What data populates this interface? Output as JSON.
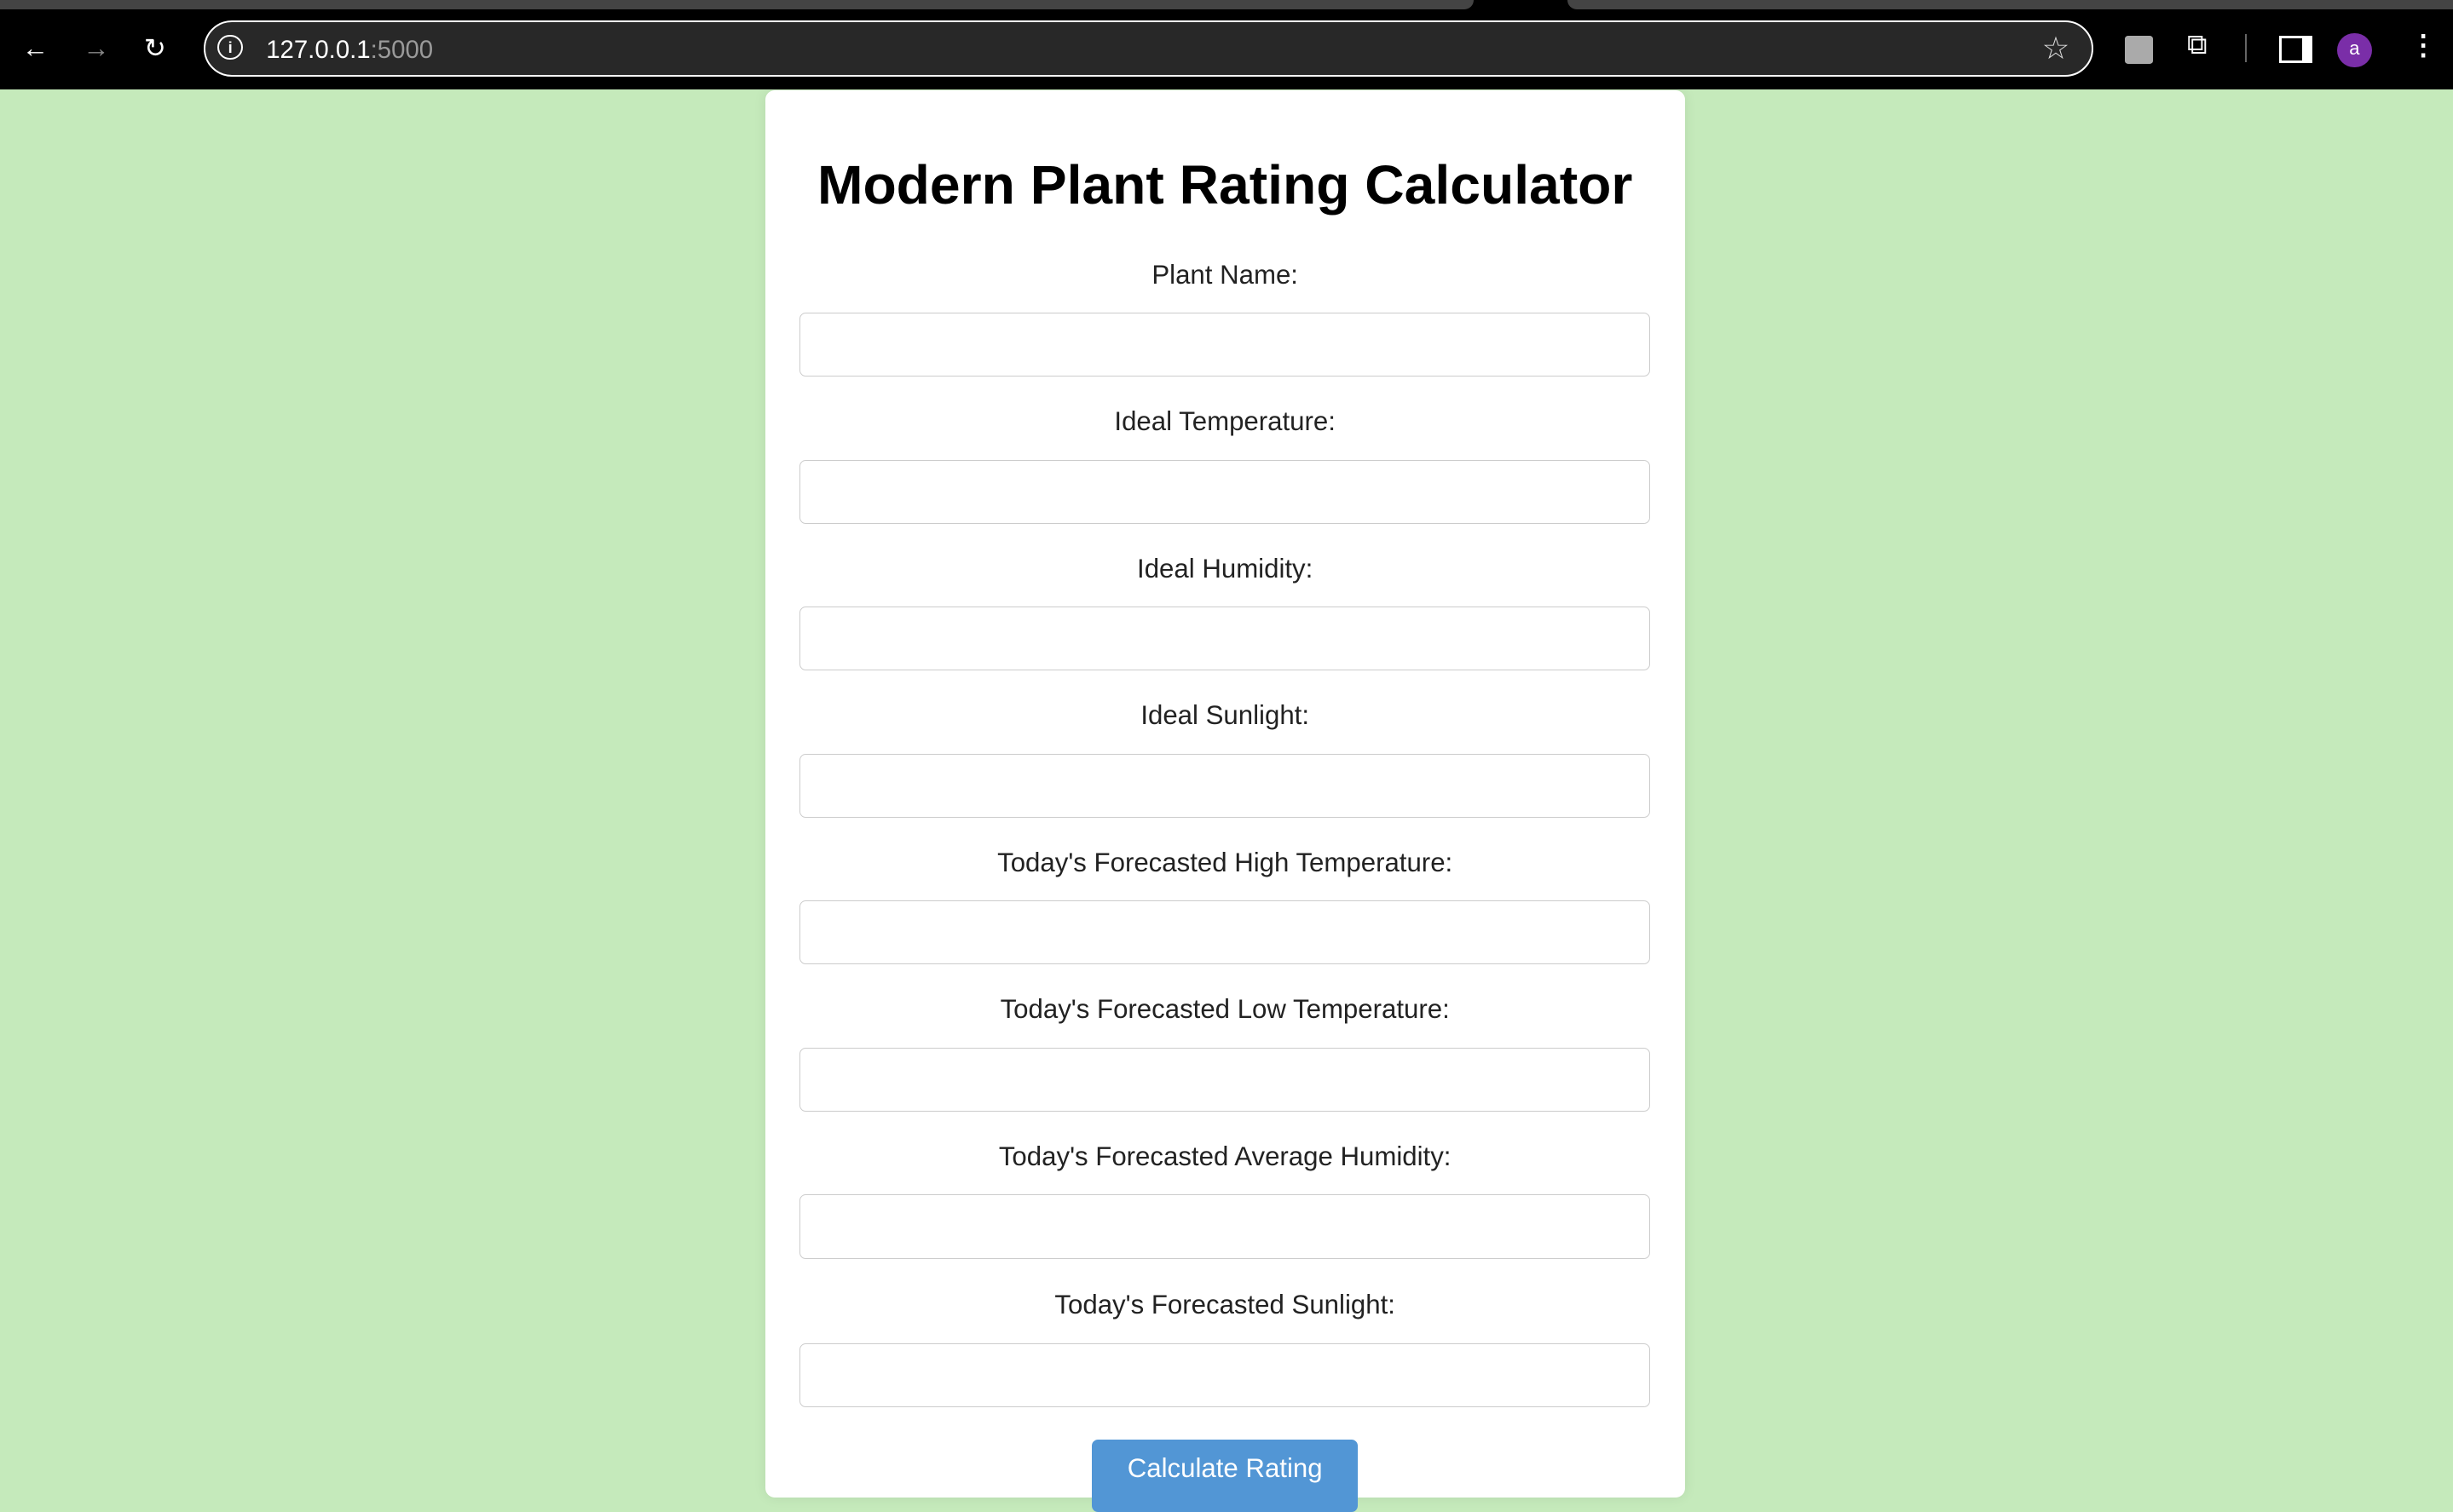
{
  "browser": {
    "url_host": "127.0.0.1",
    "url_port": ":5000"
  },
  "page": {
    "title": "Modern Plant Rating Calculator",
    "fields": [
      {
        "label": "Plant Name:",
        "value": ""
      },
      {
        "label": "Ideal Temperature:",
        "value": ""
      },
      {
        "label": "Ideal Humidity:",
        "value": ""
      },
      {
        "label": "Ideal Sunlight:",
        "value": ""
      },
      {
        "label": "Today's Forecasted High Temperature:",
        "value": ""
      },
      {
        "label": "Today's Forecasted Low Temperature:",
        "value": ""
      },
      {
        "label": "Today's Forecasted Average Humidity:",
        "value": ""
      },
      {
        "label": "Today's Forecasted Sunlight:",
        "value": ""
      }
    ],
    "submit_label": "Calculate Rating"
  },
  "profile_initial": "a",
  "colors": {
    "background": "#c5eabb",
    "button": "#5296d5",
    "avatar": "#7a2ea8"
  }
}
